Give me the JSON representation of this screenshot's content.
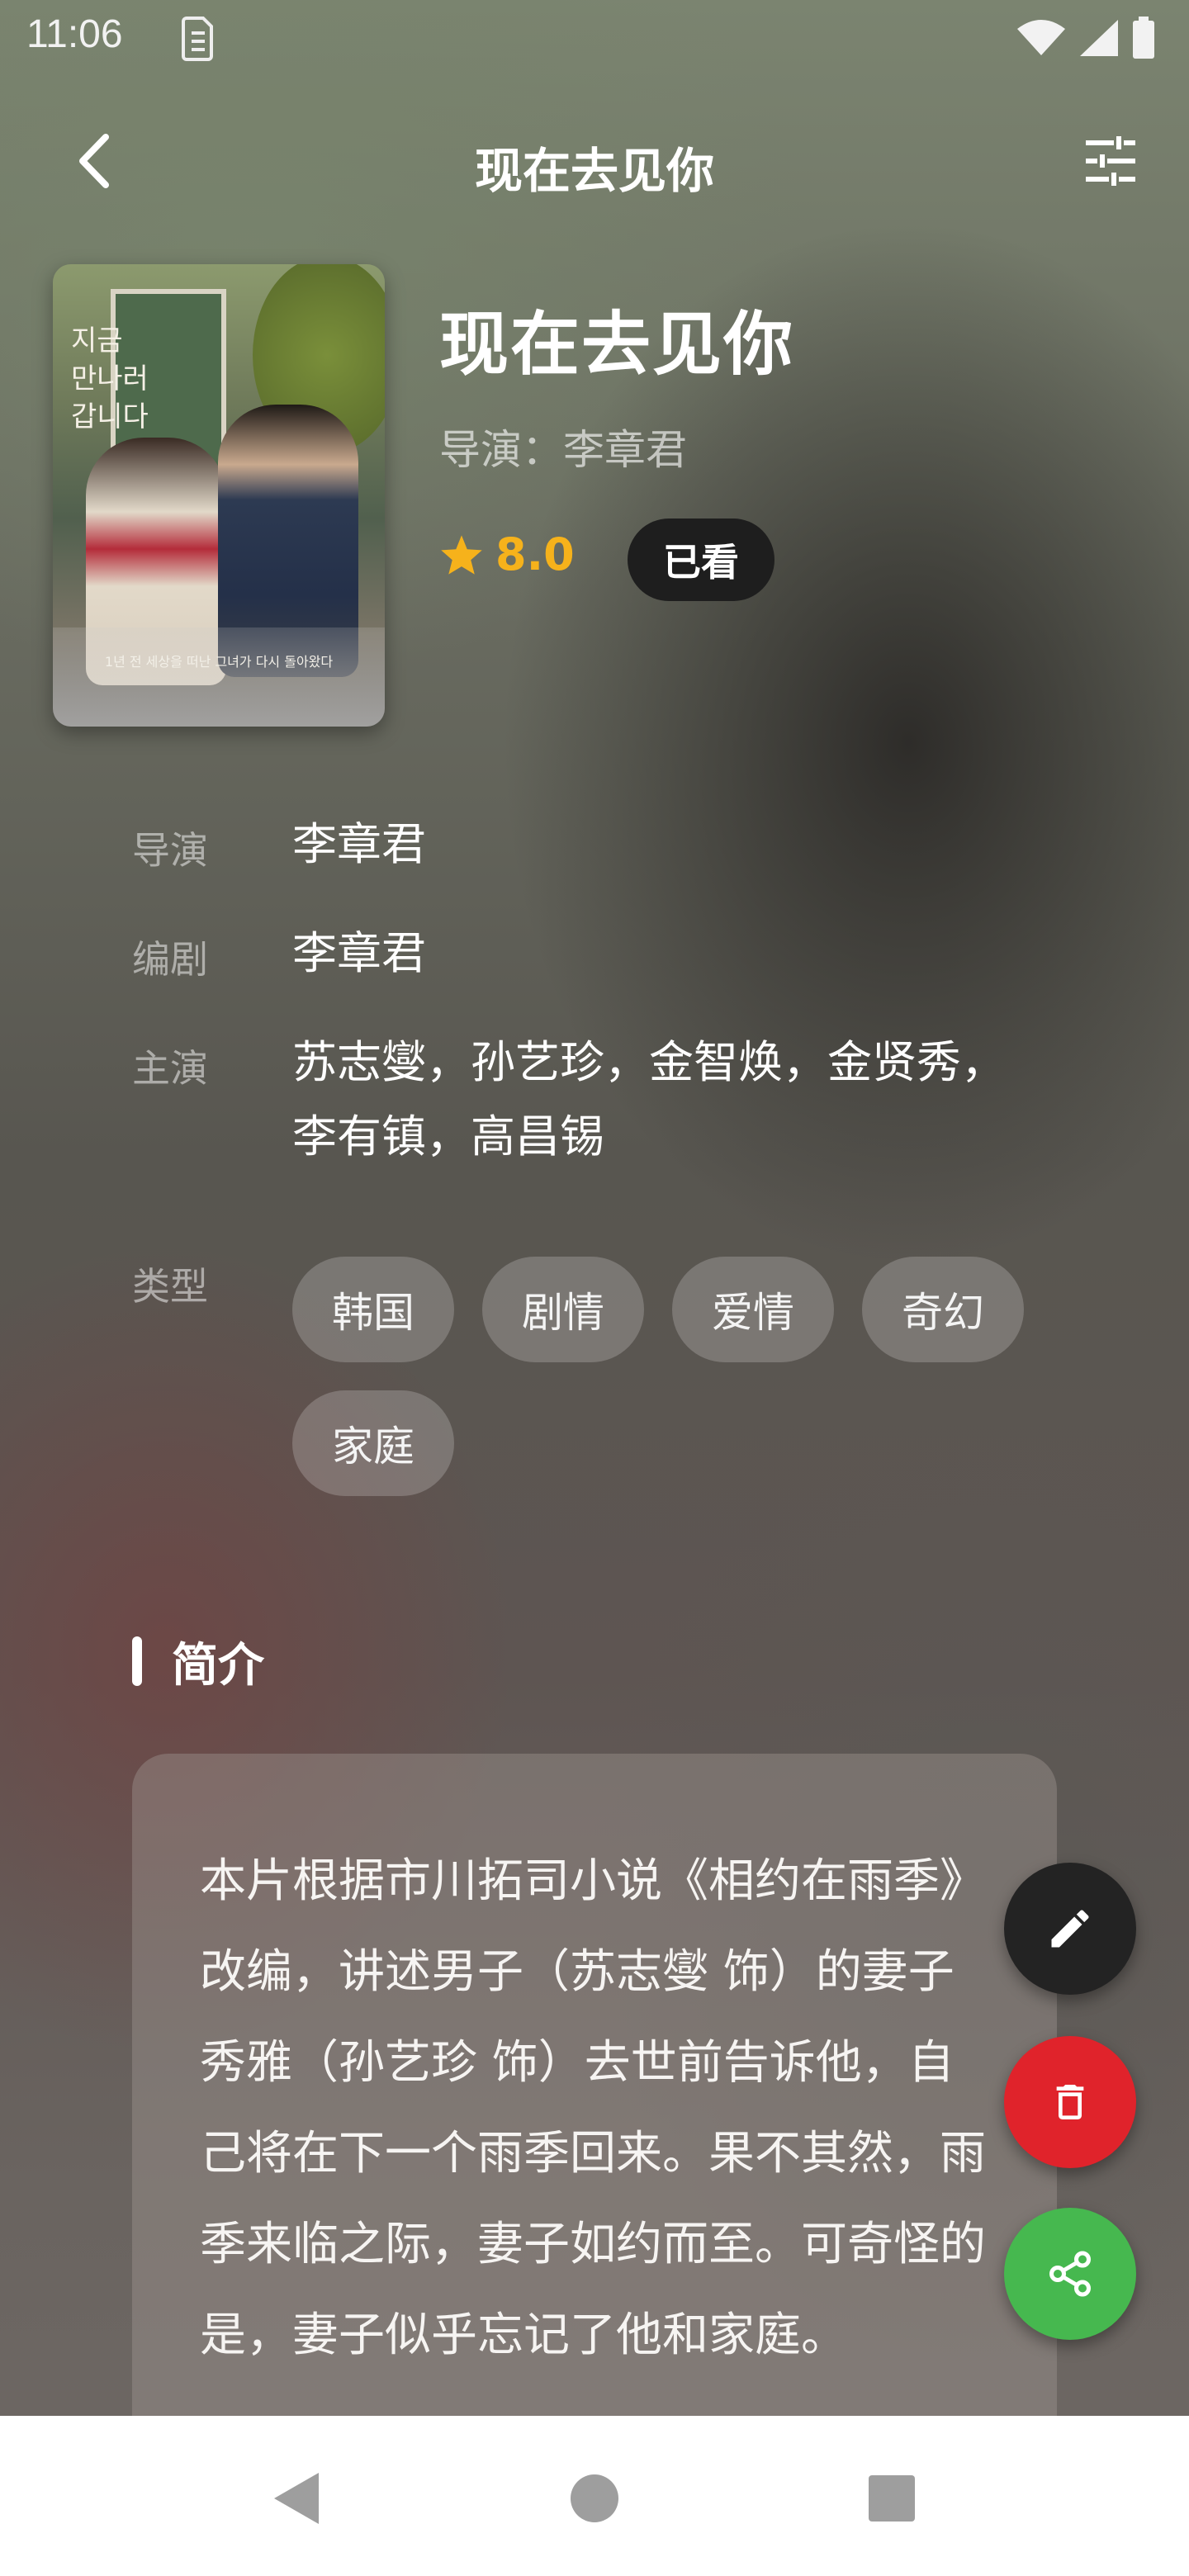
{
  "status_bar": {
    "time": "11:06",
    "icons": [
      "sim-card-icon",
      "wifi-icon",
      "signal-icon",
      "battery-icon"
    ]
  },
  "app_bar": {
    "title": "现在去见你",
    "back_icon": "arrow-back-icon",
    "filter_icon": "tune-icon"
  },
  "movie": {
    "title": "现在去见你",
    "director_line": "导演：李章君",
    "rating": "8.0",
    "watched_label": "已看",
    "poster_caption_1": "지금\n만나러\n갑니다",
    "poster_caption_2": "1년 전 세상을 떠난 그녀가 다시 돌아왔다"
  },
  "info": {
    "director_label": "导演",
    "director": "李章君",
    "writer_label": "编剧",
    "writer": "李章君",
    "cast_label": "主演",
    "cast": "苏志燮，孙艺珍，金智焕，金贤秀，李有镇，高昌锡",
    "genre_label": "类型",
    "genres": [
      "韩国",
      "剧情",
      "爱情",
      "奇幻",
      "家庭"
    ]
  },
  "synopsis": {
    "title": "简介",
    "text": "本片根据市川拓司小说《相约在雨季》改编，讲述男子（苏志燮 饰）的妻子秀雅（孙艺珍 饰）去世前告诉他，自己将在下一个雨季回来。果不其然，雨季来临之际，妻子如约而至。可奇怪的是，妻子似乎忘记了他和家庭。"
  },
  "fabs": {
    "edit_icon": "edit-icon",
    "delete_icon": "delete-icon",
    "share_icon": "share-icon"
  },
  "colors": {
    "rating_star": "#f6b21b",
    "delete_fab": "#e0232b",
    "share_fab": "#46b84f",
    "edit_fab": "#232323",
    "watched_chip": "#1e1e1e"
  }
}
